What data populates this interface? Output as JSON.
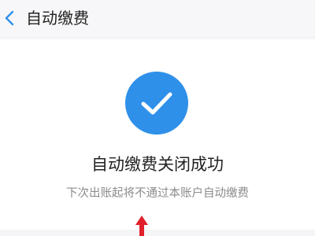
{
  "header": {
    "title": "自动缴费",
    "back_icon": "chevron-left-icon"
  },
  "result": {
    "icon": "check-circle-icon",
    "title": "自动缴费关闭成功",
    "subtitle": "下次出账起将不通过本账户自动缴费"
  },
  "annotation": {
    "icon": "arrow-up-icon"
  },
  "colors": {
    "accent": "#2f90e9",
    "annotation": "#e0202a",
    "page_background": "#f5f5f7",
    "card_background": "#ffffff"
  }
}
